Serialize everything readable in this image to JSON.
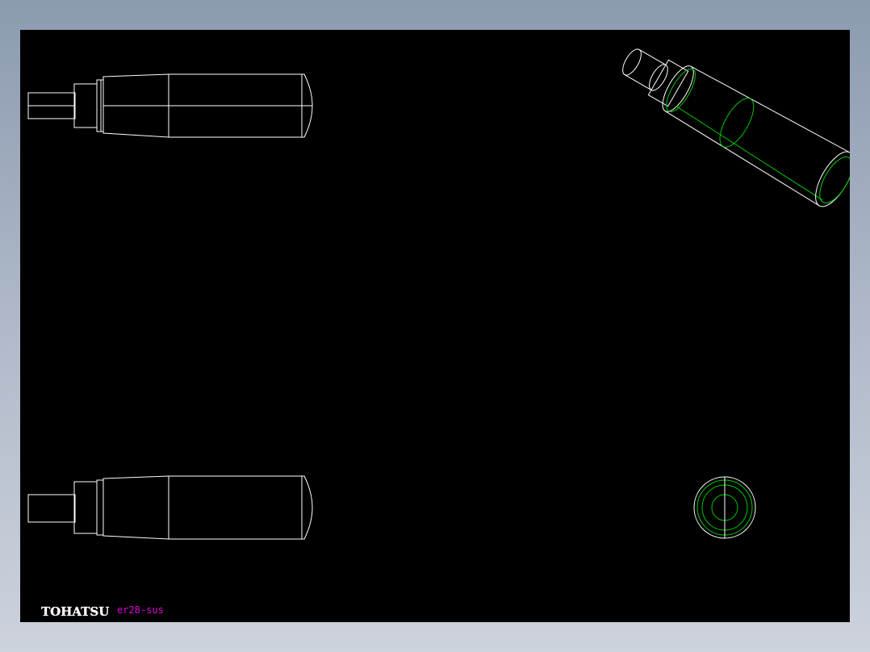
{
  "drawing": {
    "brand_text": "TOHATSU",
    "model_label": "er28-sus",
    "colors": {
      "background": "#000000",
      "line": "#ffffff",
      "hidden_line": "#00c800",
      "label": "#e000e0"
    }
  }
}
